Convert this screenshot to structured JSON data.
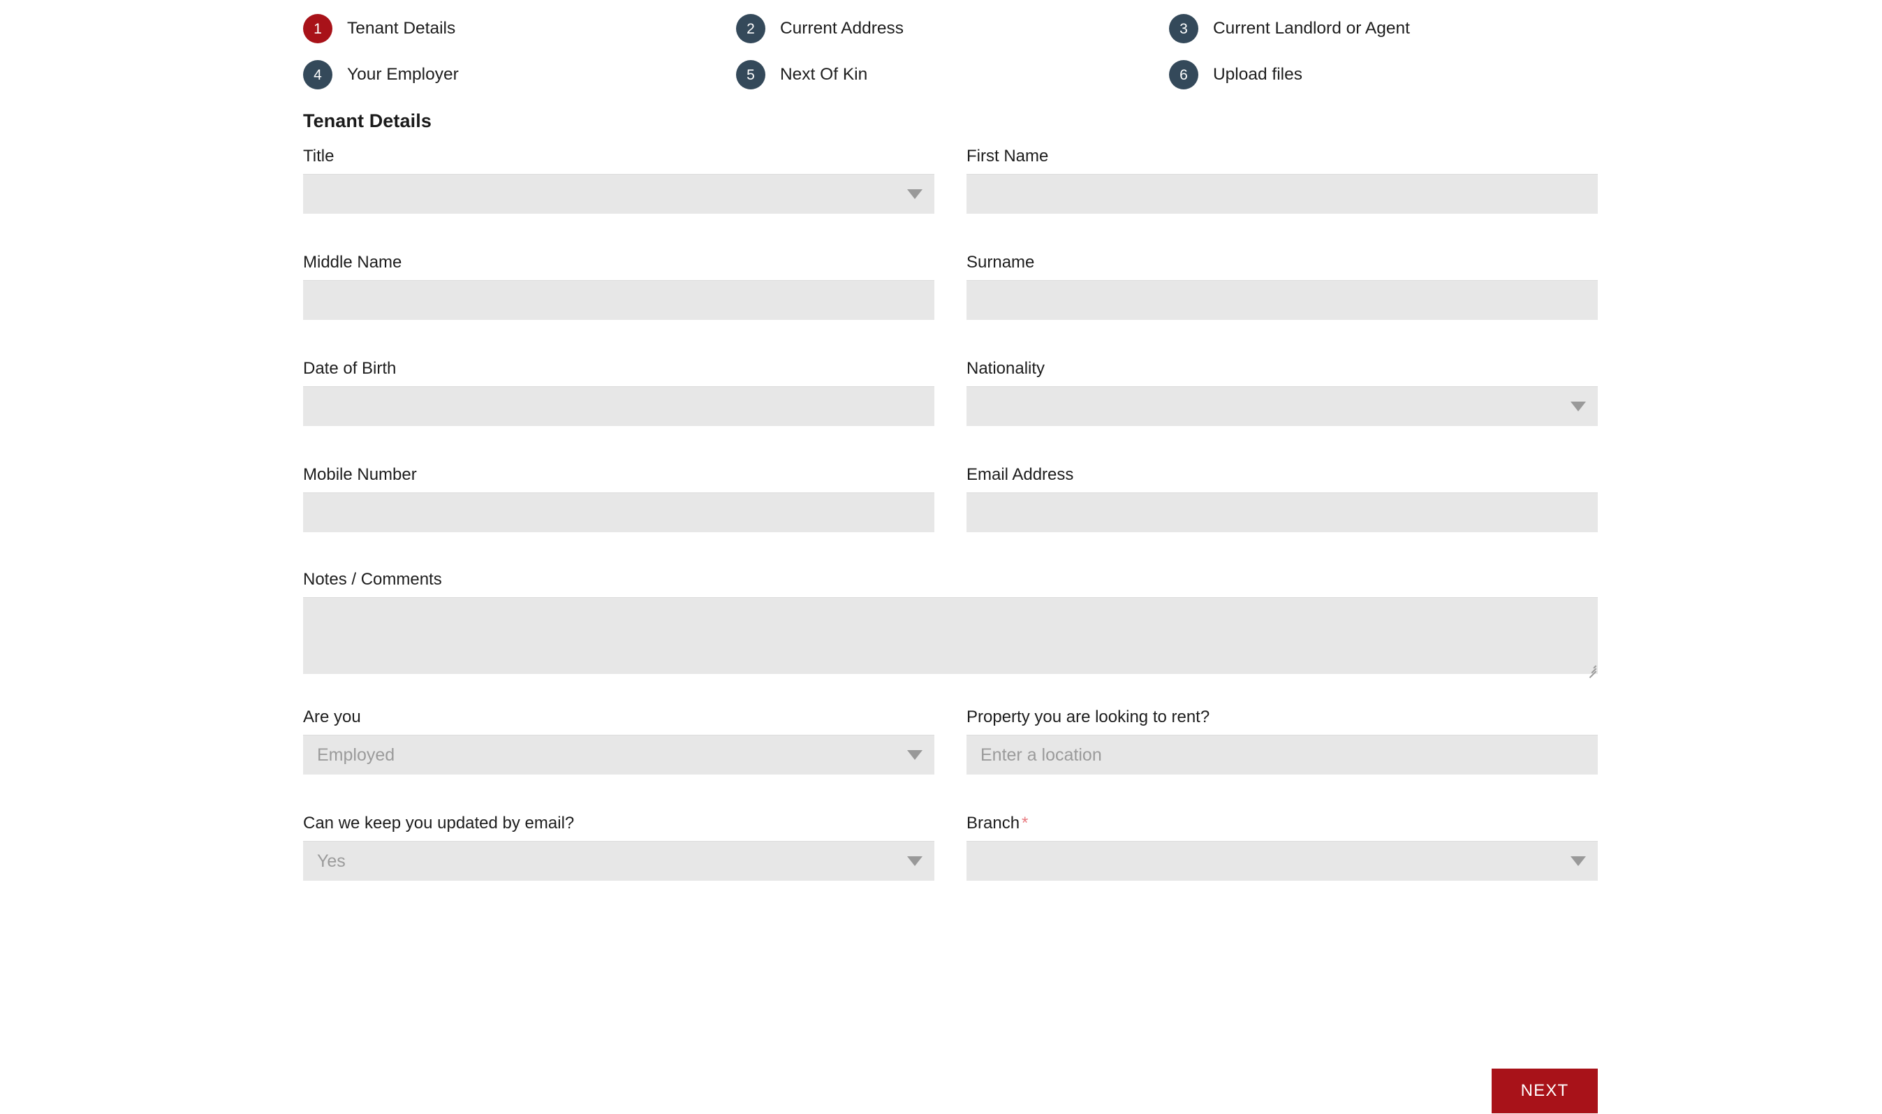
{
  "steps": [
    {
      "number": "1",
      "label": "Tenant Details",
      "active": true
    },
    {
      "number": "2",
      "label": "Current Address",
      "active": false
    },
    {
      "number": "3",
      "label": "Current Landlord or Agent",
      "active": false
    },
    {
      "number": "4",
      "label": "Your Employer",
      "active": false
    },
    {
      "number": "5",
      "label": "Next Of Kin",
      "active": false
    },
    {
      "number": "6",
      "label": "Upload files",
      "active": false
    }
  ],
  "section": {
    "title": "Tenant Details"
  },
  "fields": {
    "title": {
      "label": "Title",
      "value": "",
      "type": "select"
    },
    "first_name": {
      "label": "First Name",
      "value": "",
      "type": "text"
    },
    "middle_name": {
      "label": "Middle Name",
      "value": "",
      "type": "text"
    },
    "surname": {
      "label": "Surname",
      "value": "",
      "type": "text"
    },
    "date_of_birth": {
      "label": "Date of Birth",
      "value": "",
      "type": "text"
    },
    "nationality": {
      "label": "Nationality",
      "value": "",
      "type": "select"
    },
    "mobile_number": {
      "label": "Mobile Number",
      "value": "",
      "type": "text"
    },
    "email_address": {
      "label": "Email Address",
      "value": "",
      "type": "text"
    },
    "notes": {
      "label": "Notes / Comments",
      "value": "",
      "type": "textarea"
    },
    "are_you": {
      "label": "Are you",
      "value": "Employed",
      "type": "select"
    },
    "property": {
      "label": "Property you are looking to rent?",
      "value": "Enter a location",
      "type": "text"
    },
    "email_updates": {
      "label": "Can we keep you updated by email?",
      "value": "Yes",
      "type": "select"
    },
    "branch": {
      "label": "Branch",
      "value": "",
      "type": "select",
      "required_marker": "*"
    }
  },
  "footer": {
    "next_label": "NEXT"
  },
  "colors": {
    "active_step": "#a81219",
    "inactive_step": "#34495a",
    "field_background": "#e7e7e7",
    "button": "#a81219",
    "required_asterisk": "#e8797f"
  }
}
